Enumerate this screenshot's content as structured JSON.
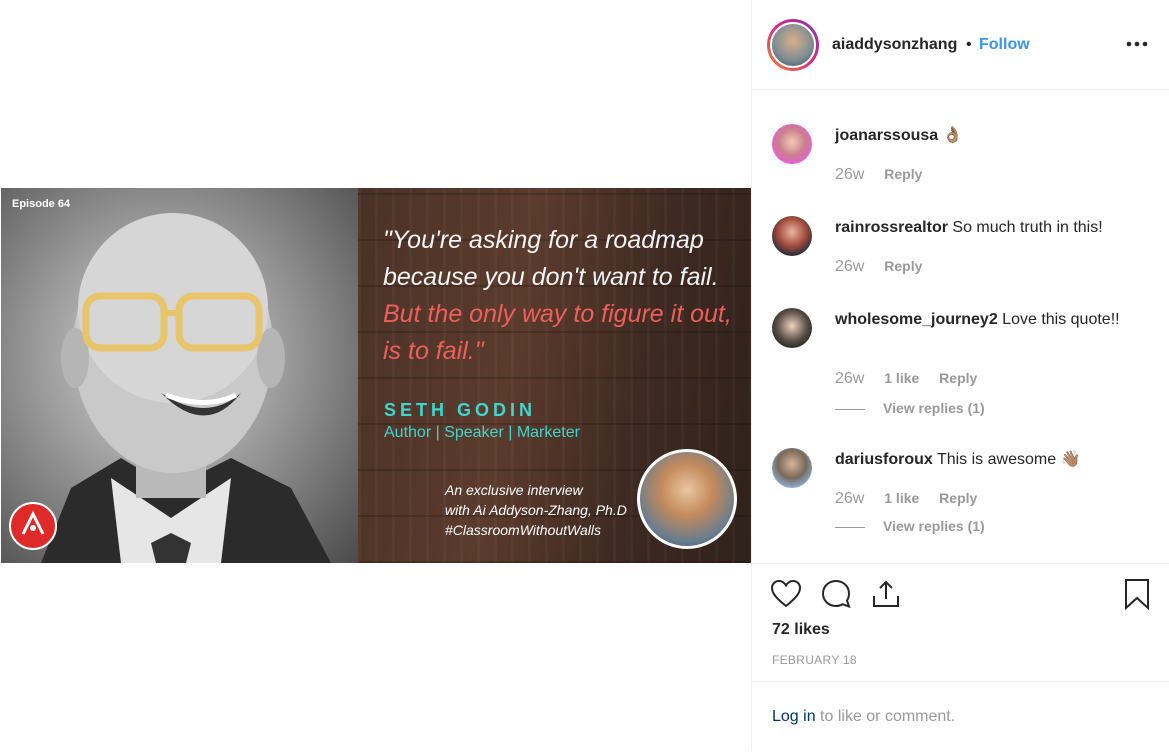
{
  "post": {
    "episode": "Episode 64",
    "quote_white": "\"You're asking for a roadmap because you don't want to fail.",
    "quote_red": "But the only way to figure it out, is to fail.\"",
    "guest_name": "SETH GODIN",
    "guest_roles": "Author | Speaker | Marketer",
    "interview_line1": "An exclusive interview",
    "interview_line2": "with Ai Addyson-Zhang, Ph.D",
    "interview_line3": "#ClassroomWithoutWalls"
  },
  "header": {
    "username": "aiaddysonzhang",
    "separator": "•",
    "follow_label": "Follow"
  },
  "comments": [
    {
      "username": "joanarssousa",
      "text": "👌🏽",
      "age": "26w",
      "likes": "",
      "reply_label": "Reply",
      "view_replies": ""
    },
    {
      "username": "rainrossrealtor",
      "text": "So much truth in this!",
      "age": "26w",
      "likes": "",
      "reply_label": "Reply",
      "view_replies": ""
    },
    {
      "username": "wholesome_journey2",
      "text": "Love this quote!!",
      "age": "26w",
      "likes": "1 like",
      "reply_label": "Reply",
      "view_replies": "View replies (1)"
    },
    {
      "username": "dariusforoux",
      "text": "This is awesome 👋🏽",
      "age": "26w",
      "likes": "1 like",
      "reply_label": "Reply",
      "view_replies": "View replies (1)"
    }
  ],
  "actions": {
    "likes_count": "72 likes",
    "date": "FEBRUARY 18"
  },
  "login": {
    "link": "Log in",
    "rest": " to like or comment."
  },
  "icons": [
    "more-options-icon",
    "heart-icon",
    "comment-icon",
    "share-icon",
    "bookmark-icon"
  ],
  "colors": {
    "link": "#3897f0",
    "quote_accent": "#ee5f5b",
    "name_accent": "#3fd6cf"
  }
}
